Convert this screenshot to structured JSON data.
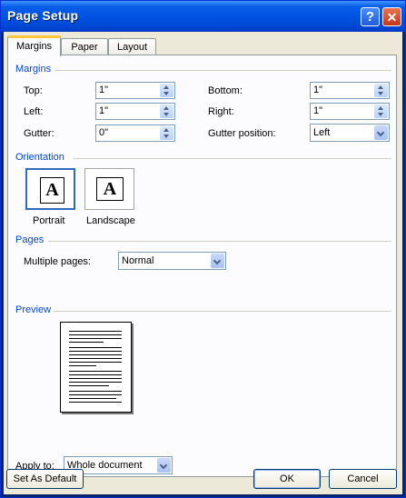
{
  "window": {
    "title": "Page Setup"
  },
  "tabs": [
    "Margins",
    "Paper",
    "Layout"
  ],
  "margins": {
    "heading": "Margins",
    "top": {
      "label": "Top:",
      "value": "1\""
    },
    "left": {
      "label": "Left:",
      "value": "1\""
    },
    "gutter": {
      "label": "Gutter:",
      "value": "0\""
    },
    "bottom": {
      "label": "Bottom:",
      "value": "1\""
    },
    "right": {
      "label": "Right:",
      "value": "1\""
    },
    "gutter_position": {
      "label": "Gutter position:",
      "value": "Left"
    }
  },
  "orientation": {
    "heading": "Orientation",
    "portrait": "Portrait",
    "landscape": "Landscape",
    "glyph": "A"
  },
  "pages": {
    "heading": "Pages",
    "multiple_pages_label": "Multiple pages:",
    "multiple_pages_value": "Normal"
  },
  "preview": {
    "heading": "Preview"
  },
  "apply": {
    "label": "Apply to:",
    "value": "Whole document"
  },
  "buttons": {
    "set_default": "Set As Default",
    "ok": "OK",
    "cancel": "Cancel"
  }
}
